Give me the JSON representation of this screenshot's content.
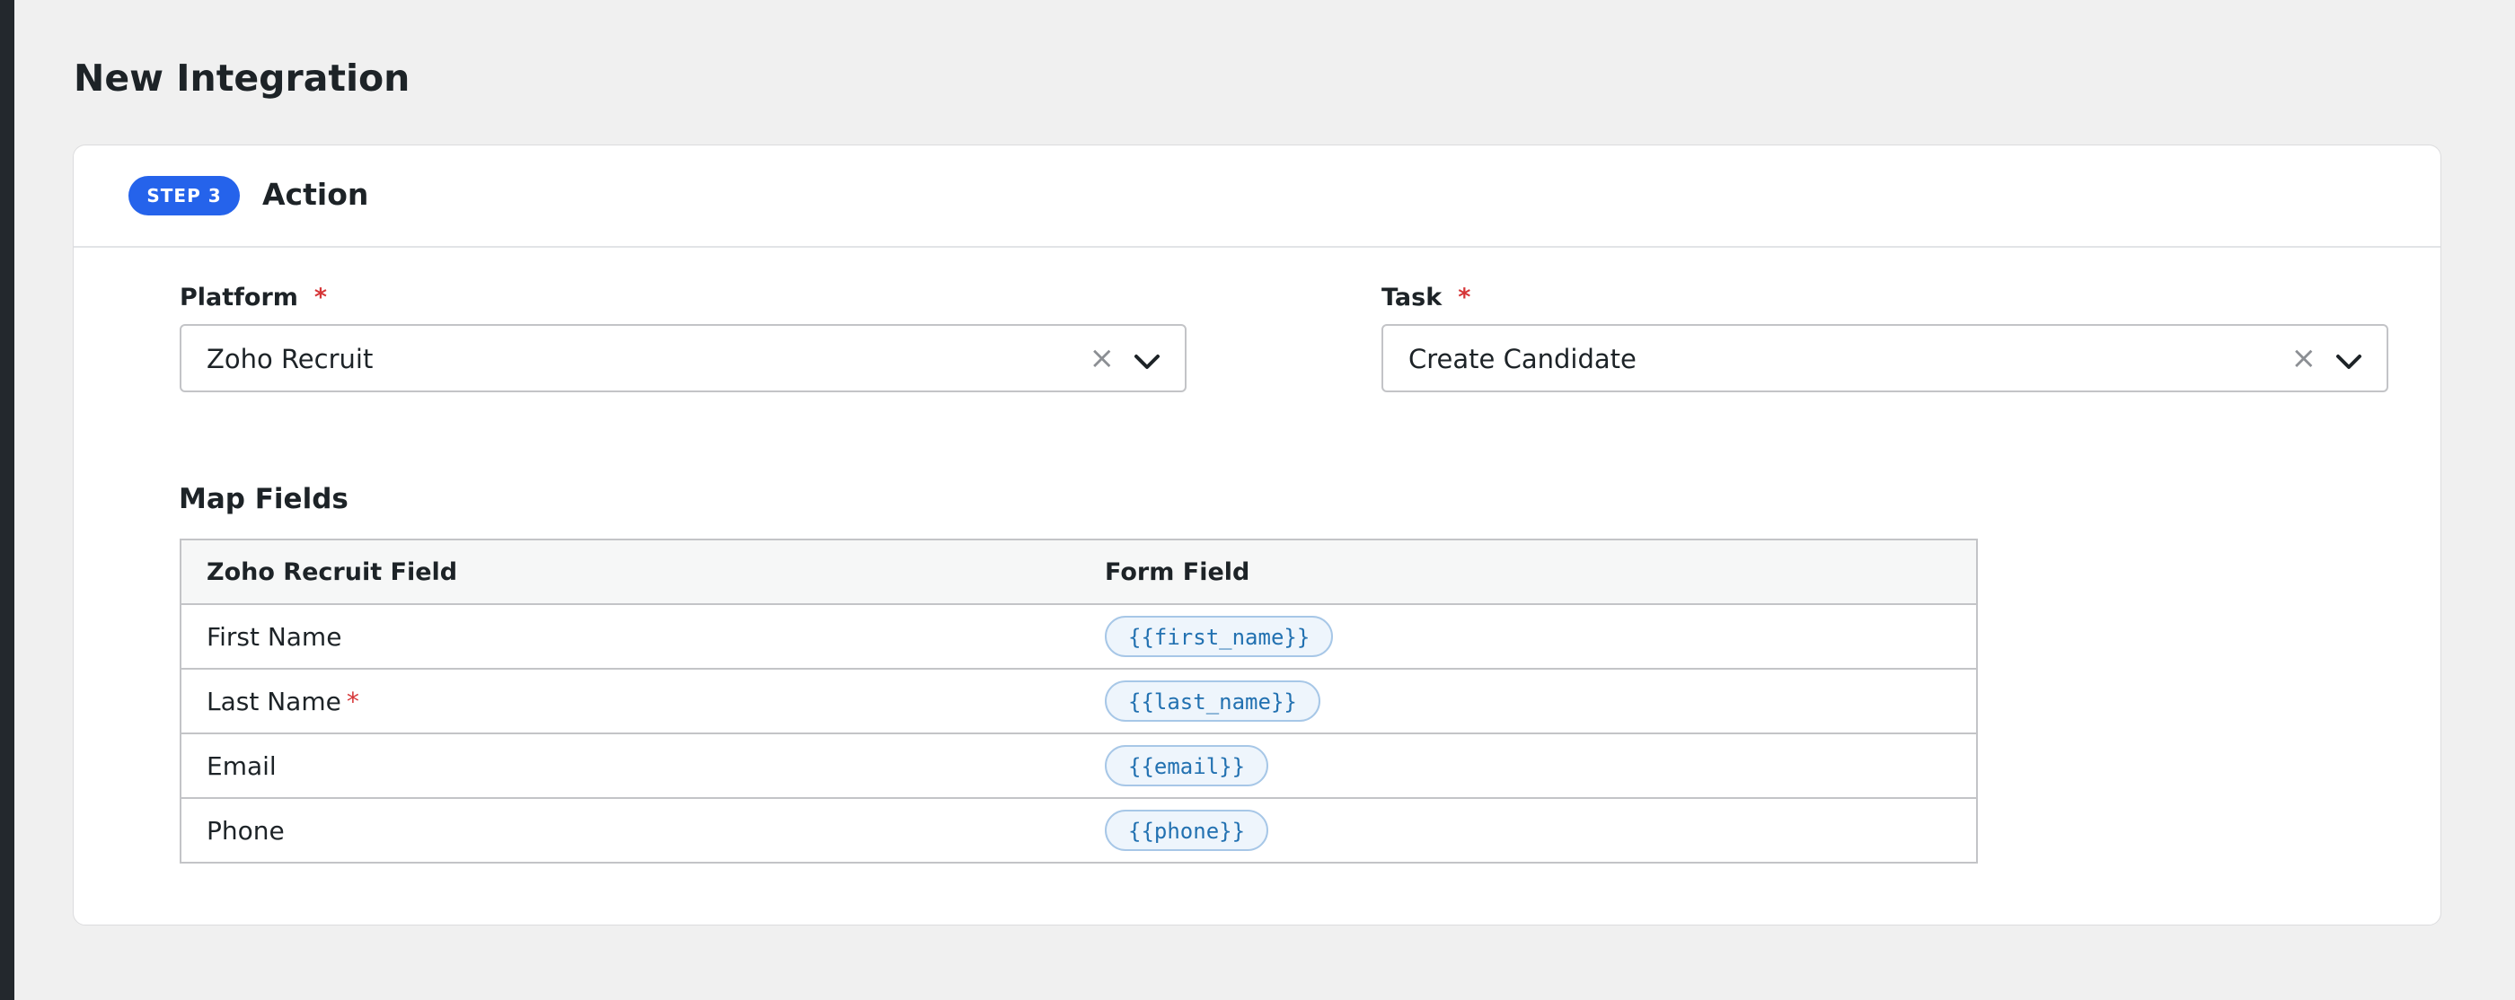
{
  "page": {
    "title": "New Integration"
  },
  "step": {
    "badge": "STEP 3",
    "title": "Action"
  },
  "platform": {
    "label": "Platform",
    "required_mark": "*",
    "value": "Zoho Recruit",
    "clear_glyph": "×"
  },
  "task": {
    "label": "Task",
    "required_mark": "*",
    "value": "Create Candidate",
    "clear_glyph": "×"
  },
  "map_fields": {
    "title": "Map Fields",
    "columns": [
      "Zoho Recruit Field",
      "Form Field"
    ],
    "rows": [
      {
        "field": "First Name",
        "required": false,
        "token": "{{first_name}}"
      },
      {
        "field": "Last Name",
        "required": true,
        "required_mark": "*",
        "token": "{{last_name}}"
      },
      {
        "field": "Email",
        "required": false,
        "token": "{{email}}"
      },
      {
        "field": "Phone",
        "required": false,
        "token": "{{phone}}"
      }
    ]
  },
  "icons": {
    "clear": "close-icon",
    "dropdown": "chevron-down-icon"
  },
  "colors": {
    "accent": "#2563eb",
    "required": "#d63638",
    "token_text": "#2271b1"
  }
}
